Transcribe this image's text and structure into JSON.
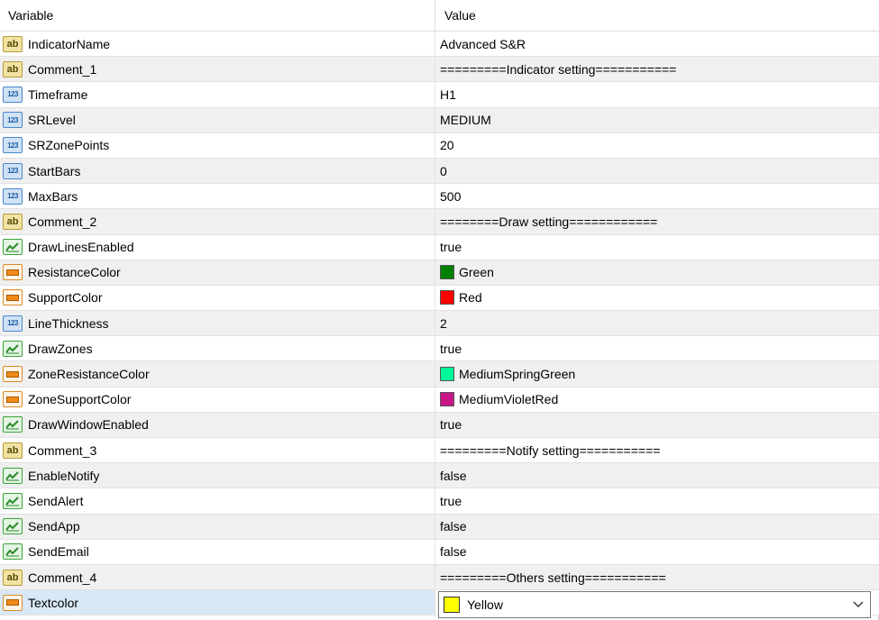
{
  "header": {
    "variable": "Variable",
    "value": "Value"
  },
  "rows": [
    {
      "name": "IndicatorName",
      "type": "string",
      "value": "Advanced S&R"
    },
    {
      "name": "Comment_1",
      "type": "string",
      "value": "=========Indicator setting==========="
    },
    {
      "name": "Timeframe",
      "type": "int",
      "value": "H1"
    },
    {
      "name": "SRLevel",
      "type": "int",
      "value": "MEDIUM"
    },
    {
      "name": "SRZonePoints",
      "type": "int",
      "value": "20"
    },
    {
      "name": "StartBars",
      "type": "int",
      "value": "0"
    },
    {
      "name": "MaxBars",
      "type": "int",
      "value": "500"
    },
    {
      "name": "Comment_2",
      "type": "string",
      "value": "========Draw setting============"
    },
    {
      "name": "DrawLinesEnabled",
      "type": "bool",
      "value": "true"
    },
    {
      "name": "ResistanceColor",
      "type": "color",
      "value": "Green",
      "swatch": "#008000"
    },
    {
      "name": "SupportColor",
      "type": "color",
      "value": "Red",
      "swatch": "#ff0000"
    },
    {
      "name": "LineThickness",
      "type": "int",
      "value": "2"
    },
    {
      "name": "DrawZones",
      "type": "bool",
      "value": "true"
    },
    {
      "name": "ZoneResistanceColor",
      "type": "color",
      "value": "MediumSpringGreen",
      "swatch": "#00fa9a"
    },
    {
      "name": "ZoneSupportColor",
      "type": "color",
      "value": "MediumVioletRed",
      "swatch": "#c71585"
    },
    {
      "name": "DrawWindowEnabled",
      "type": "bool",
      "value": "true"
    },
    {
      "name": "Comment_3",
      "type": "string",
      "value": "=========Notify setting==========="
    },
    {
      "name": "EnableNotify",
      "type": "bool",
      "value": "false"
    },
    {
      "name": "SendAlert",
      "type": "bool",
      "value": "true"
    },
    {
      "name": "SendApp",
      "type": "bool",
      "value": "false"
    },
    {
      "name": "SendEmail",
      "type": "bool",
      "value": "false"
    },
    {
      "name": "Comment_4",
      "type": "string",
      "value": "=========Others setting==========="
    },
    {
      "name": "Textcolor",
      "type": "color",
      "value": "Yellow",
      "swatch": "#ffff00",
      "selected": true
    }
  ],
  "icons": {
    "string": {
      "name": "string-type-icon",
      "glyph": "ab"
    },
    "int": {
      "name": "integer-type-icon",
      "glyph": "123"
    },
    "bool": {
      "name": "boolean-type-icon"
    },
    "color": {
      "name": "color-type-icon"
    }
  }
}
